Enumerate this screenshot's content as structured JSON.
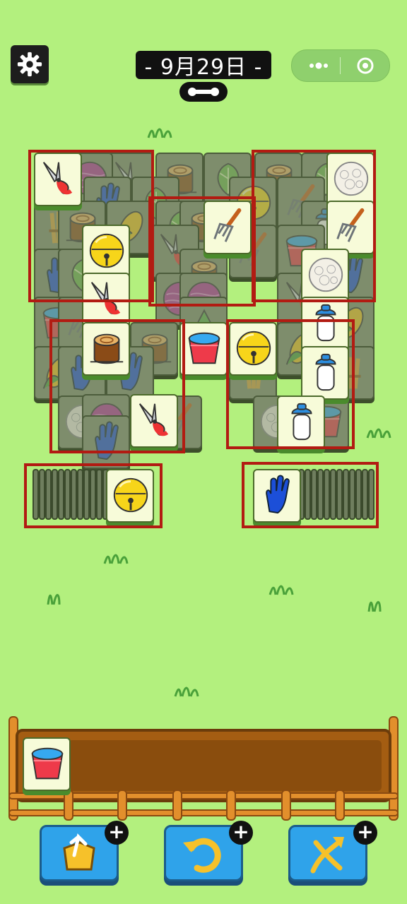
{
  "header": {
    "date_label": "- 9月29日 -"
  },
  "colors": {
    "background": "#b3f07e",
    "highlight_box": "#b21b12",
    "tile_lit": "#f7fbd9",
    "tile_dim": "#7e8d6c",
    "tray_wood": "#a45d12",
    "tool_button": "#2fa3ea"
  },
  "board": {
    "tile_types": [
      "pruning-shears",
      "yarn-ball",
      "tree-stump",
      "blue-glove",
      "corn",
      "wheat-bundle",
      "yellow-bell",
      "hay-fork",
      "red-bucket",
      "cotton-ball",
      "milk-bottle",
      "cabbage",
      "grass-sprout"
    ]
  },
  "left_stack": {
    "top_tile": "yellow-bell"
  },
  "right_stack": {
    "top_tile": "blue-glove"
  },
  "tray": {
    "slots_filled": [
      "red-bucket"
    ],
    "slot_capacity": 7
  },
  "tools": [
    {
      "icon": "shuffle-out-icon"
    },
    {
      "icon": "undo-icon"
    },
    {
      "icon": "shuffle-icon"
    }
  ]
}
